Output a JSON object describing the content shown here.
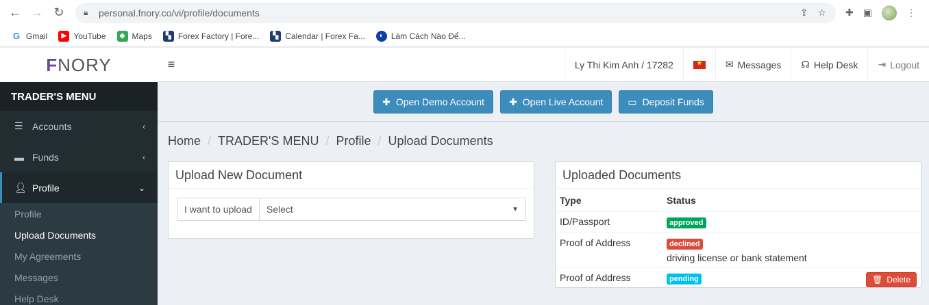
{
  "browser": {
    "url": "personal.fnory.co/vi/profile/documents",
    "bookmarks": [
      {
        "label": "Gmail",
        "icon": "gmail-icon"
      },
      {
        "label": "YouTube",
        "icon": "youtube-icon"
      },
      {
        "label": "Maps",
        "icon": "maps-icon"
      },
      {
        "label": "Forex Factory | Fore...",
        "icon": "forexfactory-icon"
      },
      {
        "label": "Calendar | Forex Fa...",
        "icon": "forexfactory-icon"
      },
      {
        "label": "Làm Cách Nào Để...",
        "icon": "site-icon"
      }
    ]
  },
  "logo": {
    "first": "F",
    "rest": "NORY"
  },
  "topbar": {
    "user": "Ly Thi Kim Anh / 17282",
    "messages": "Messages",
    "help_desk": "Help Desk",
    "logout": "Logout"
  },
  "sidebar": {
    "header": "TRADER'S MENU",
    "items": [
      {
        "label": "Accounts",
        "icon": "list-icon"
      },
      {
        "label": "Funds",
        "icon": "card-icon"
      },
      {
        "label": "Profile",
        "icon": "user-icon"
      }
    ],
    "profile_sub": [
      "Profile",
      "Upload Documents",
      "My Agreements",
      "Messages",
      "Help Desk"
    ]
  },
  "actions": {
    "open_demo": "Open Demo Account",
    "open_live": "Open Live Account",
    "deposit": "Deposit Funds"
  },
  "breadcrumb": [
    "Home",
    "TRADER'S MENU",
    "Profile",
    "Upload Documents"
  ],
  "upload": {
    "title": "Upload New Document",
    "addon": "I want to upload",
    "select_value": "Select"
  },
  "documents": {
    "title": "Uploaded Documents",
    "col_type": "Type",
    "col_status": "Status",
    "rows": [
      {
        "type": "ID/Passport",
        "status": "approved",
        "note": ""
      },
      {
        "type": "Proof of Address",
        "status": "declined",
        "note": "driving license or bank statement"
      },
      {
        "type": "Proof of Address",
        "status": "pending",
        "note": ""
      }
    ],
    "delete_label": "Delete"
  },
  "colors": {
    "approved": "#00a65a",
    "declined": "#dd4b39",
    "pending": "#00c0ef"
  }
}
